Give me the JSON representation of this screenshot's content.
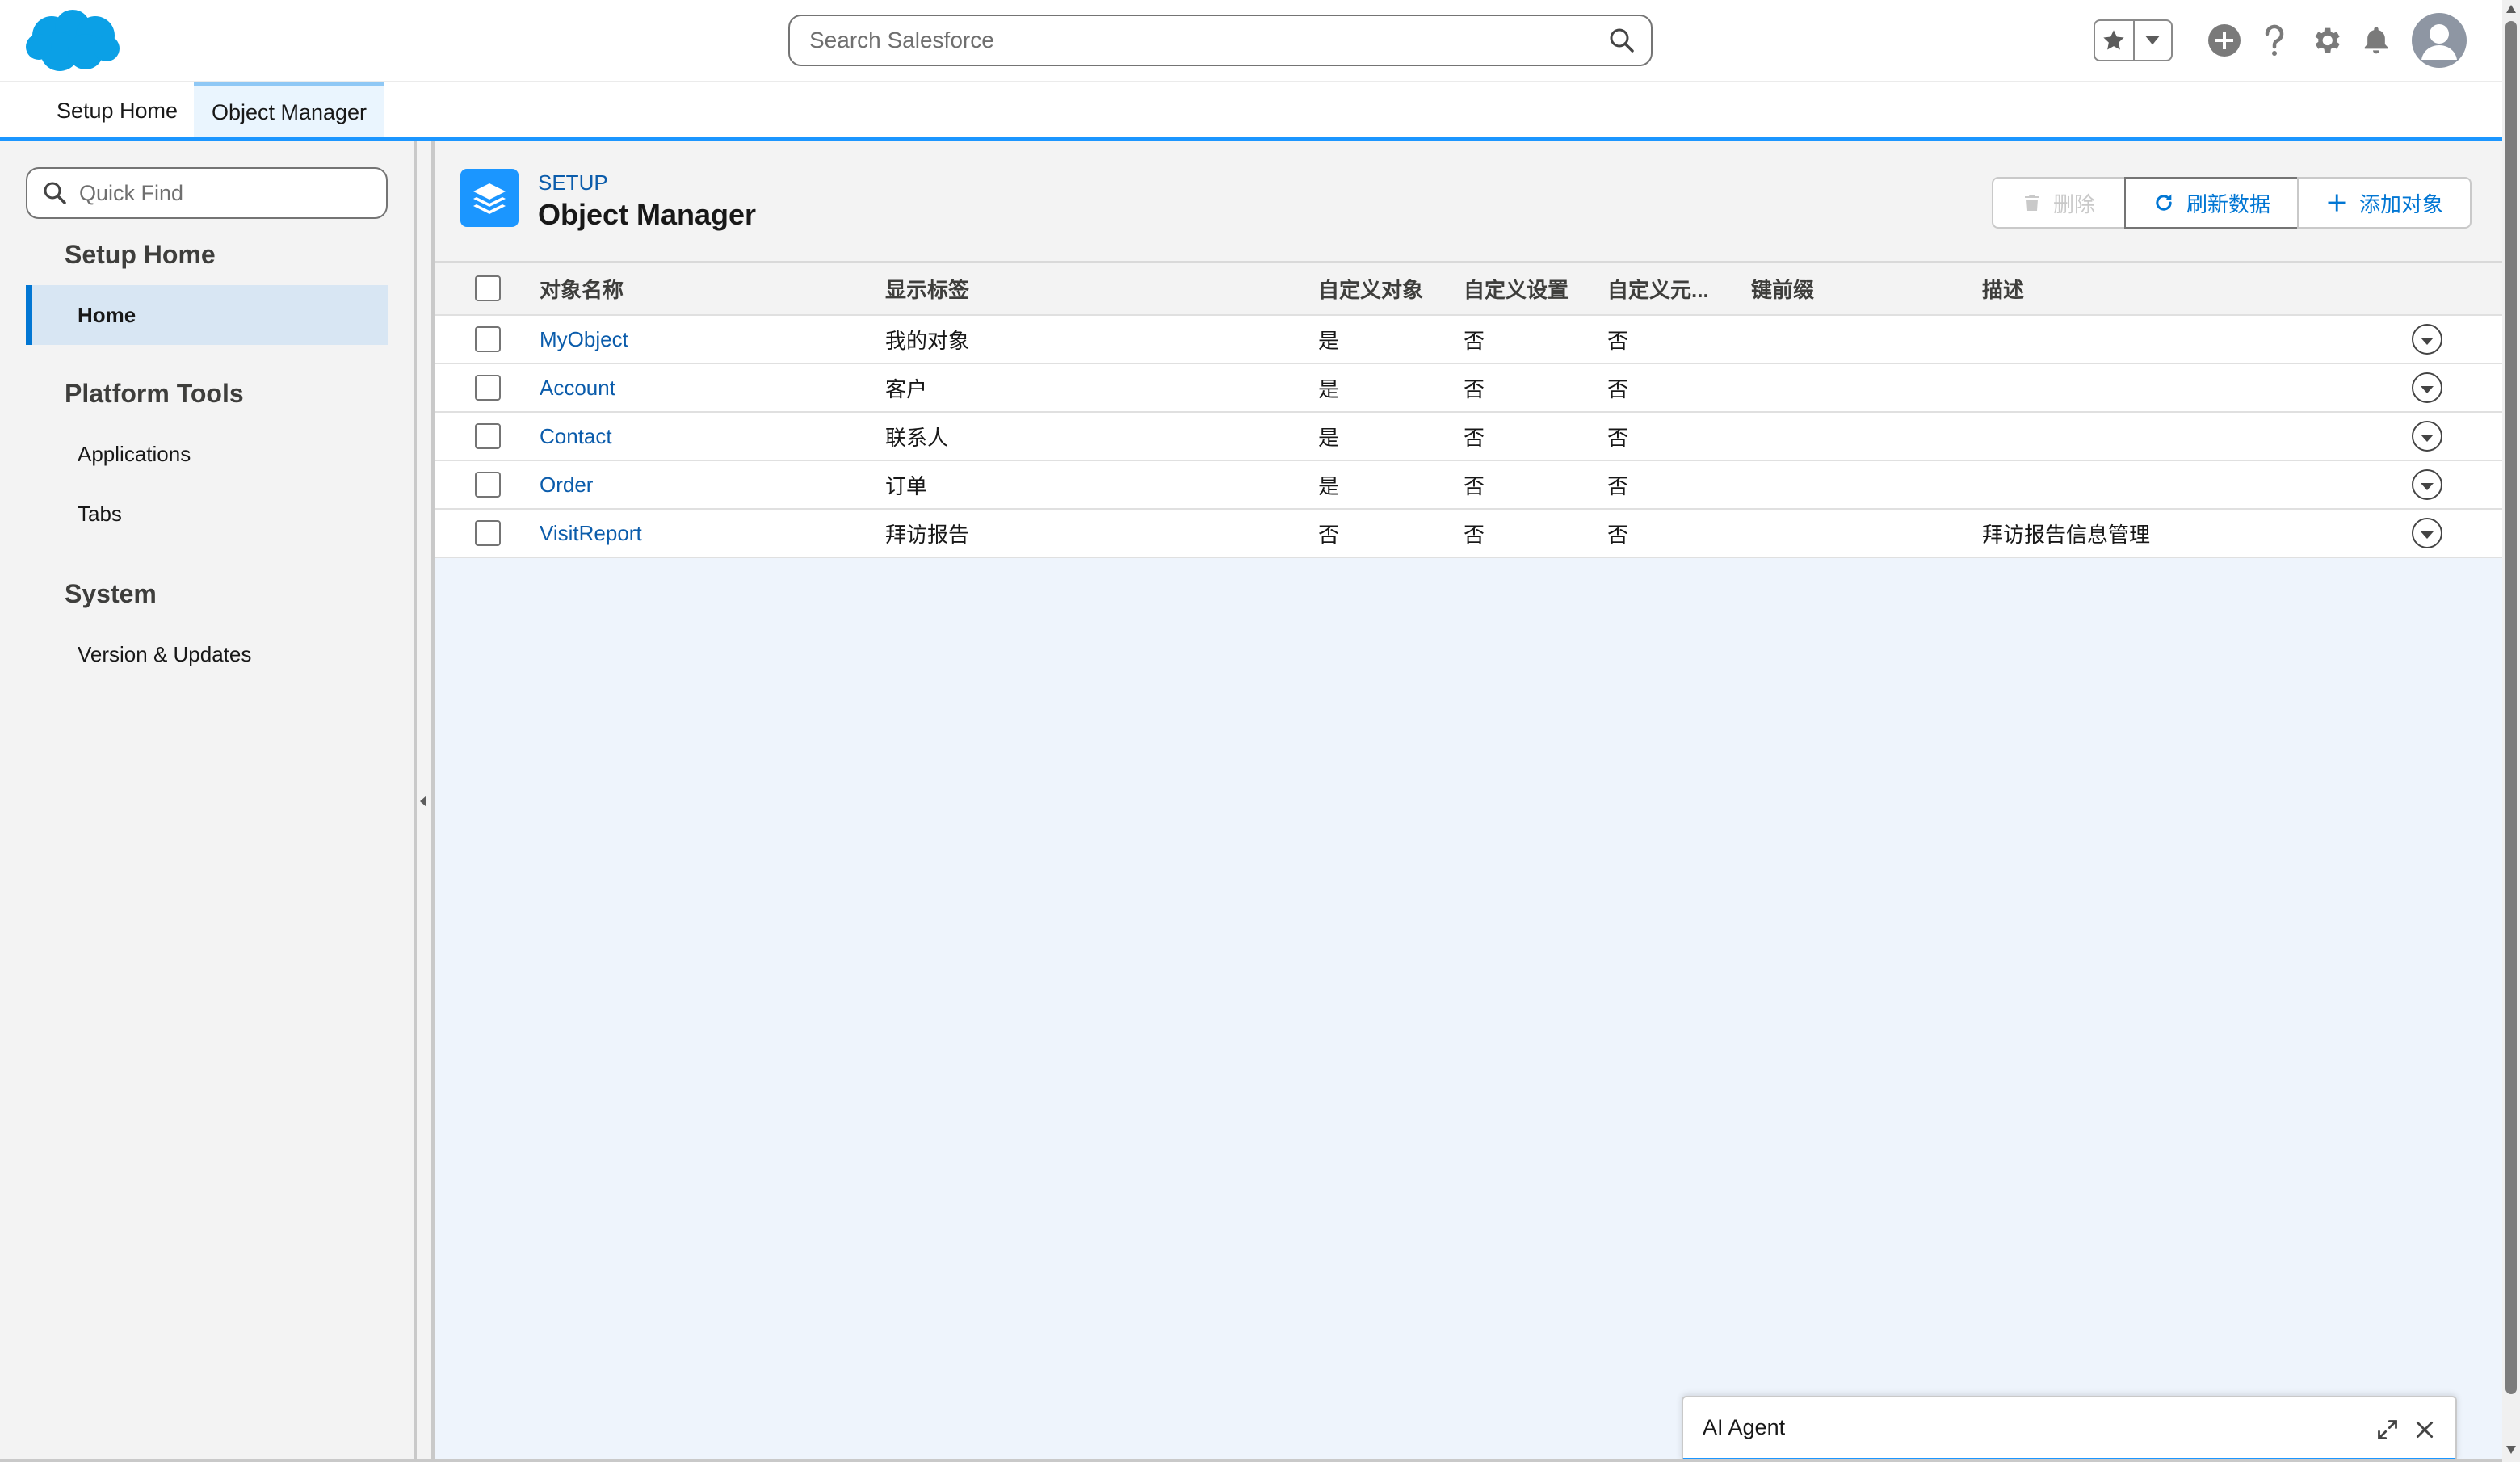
{
  "header": {
    "logo_icon": "salesforce-cloud-logo",
    "search_placeholder": "Search Salesforce",
    "icons": [
      "search-icon",
      "star-icon",
      "chevron-down-icon",
      "add-icon",
      "help-icon",
      "gear-icon",
      "bell-icon",
      "avatar-icon"
    ]
  },
  "tabs": [
    {
      "label": "Setup Home",
      "active": false
    },
    {
      "label": "Object Manager",
      "active": true
    }
  ],
  "sidebar": {
    "quick_find_placeholder": "Quick Find",
    "sections": [
      {
        "title": "Setup Home",
        "items": [
          {
            "label": "Home",
            "active": true
          }
        ]
      },
      {
        "title": "Platform Tools",
        "items": [
          {
            "label": "Applications"
          },
          {
            "label": "Tabs"
          }
        ]
      },
      {
        "title": "System",
        "items": [
          {
            "label": "Version & Updates"
          }
        ]
      }
    ]
  },
  "page_header": {
    "eyebrow": "SETUP",
    "title": "Object Manager",
    "buttons": {
      "delete": "删除",
      "refresh": "刷新数据",
      "add": "添加对象"
    }
  },
  "table": {
    "columns": [
      "对象名称",
      "显示标签",
      "自定义对象",
      "自定义设置",
      "自定义元...",
      "键前缀",
      "描述"
    ],
    "rows": [
      {
        "name": "MyObject",
        "label": "我的对象",
        "custom_object": "是",
        "custom_setting": "否",
        "custom_meta": "否",
        "key_prefix": "",
        "description": ""
      },
      {
        "name": "Account",
        "label": "客户",
        "custom_object": "是",
        "custom_setting": "否",
        "custom_meta": "否",
        "key_prefix": "",
        "description": ""
      },
      {
        "name": "Contact",
        "label": "联系人",
        "custom_object": "是",
        "custom_setting": "否",
        "custom_meta": "否",
        "key_prefix": "",
        "description": ""
      },
      {
        "name": "Order",
        "label": "订单",
        "custom_object": "是",
        "custom_setting": "否",
        "custom_meta": "否",
        "key_prefix": "",
        "description": ""
      },
      {
        "name": "VisitReport",
        "label": "拜访报告",
        "custom_object": "否",
        "custom_setting": "否",
        "custom_meta": "否",
        "key_prefix": "",
        "description": "拜访报告信息管理"
      }
    ]
  },
  "ai_agent": {
    "title": "AI Agent"
  },
  "colors": {
    "brand": "#1b96ff",
    "link": "#0b5cab",
    "sidebar_bg": "#f3f3f3",
    "main_bg": "#eef4fc"
  }
}
